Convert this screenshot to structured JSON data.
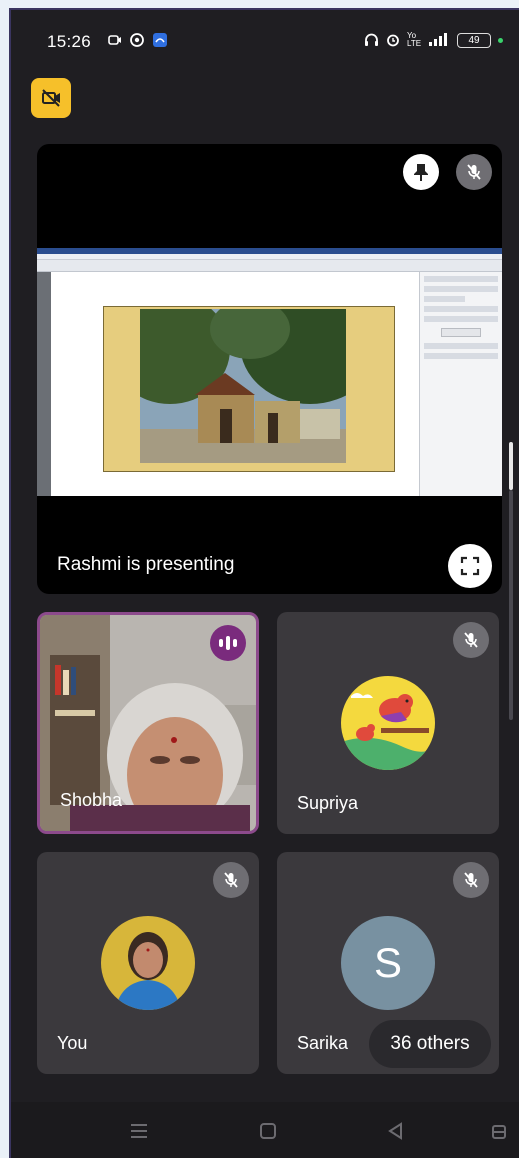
{
  "status_bar": {
    "time": "15:26",
    "network": "Yo LTE",
    "battery": "49"
  },
  "presentation": {
    "presenting_text": "Rashmi is presenting"
  },
  "participants": [
    {
      "name": "Shobha",
      "state": "speaking"
    },
    {
      "name": "Supriya",
      "state": "muted"
    },
    {
      "name": "You",
      "state": "muted"
    },
    {
      "name": "Sarika",
      "state": "muted",
      "avatar_letter": "S"
    }
  ],
  "others_chip": {
    "label": "36 others"
  },
  "colors": {
    "background": "#1f1e22",
    "tile": "#3b393d",
    "speaking_accent": "#7a2b7d",
    "camera_off_badge": "#f6c02a",
    "avatar_s": "#7891a1"
  },
  "icons": {
    "camera_off": "video-off-icon",
    "pin": "pin-icon",
    "mute": "mic-off-icon",
    "fullscreen": "fullscreen-icon",
    "speaking": "audio-level-icon"
  }
}
